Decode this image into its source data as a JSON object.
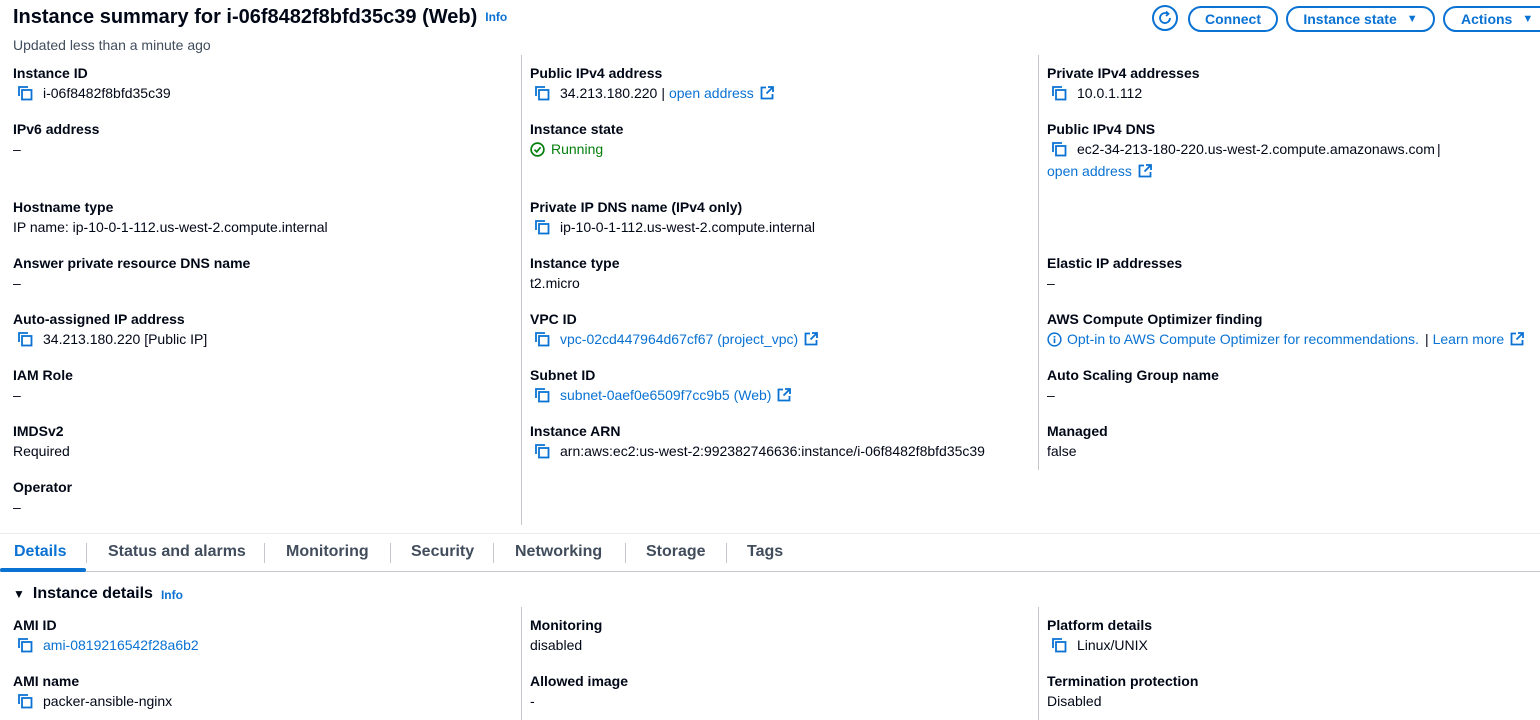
{
  "header": {
    "title": "Instance summary for i-06f8482f8bfd35c39 (Web)",
    "info": "Info",
    "updated": "Updated less than a minute ago",
    "buttons": {
      "connect": "Connect",
      "instance_state": "Instance state",
      "actions": "Actions"
    }
  },
  "summary": {
    "instance_id": {
      "label": "Instance ID",
      "value": "i-06f8482f8bfd35c39"
    },
    "ipv6": {
      "label": "IPv6 address",
      "value": "–"
    },
    "hostname_type": {
      "label": "Hostname type",
      "value": "IP name: ip-10-0-1-112.us-west-2.compute.internal"
    },
    "answer_dns": {
      "label": "Answer private resource DNS name",
      "value": "–"
    },
    "auto_ip": {
      "label": "Auto-assigned IP address",
      "value": "34.213.180.220 [Public IP]"
    },
    "iam_role": {
      "label": "IAM Role",
      "value": "–"
    },
    "imdsv2": {
      "label": "IMDSv2",
      "value": "Required"
    },
    "operator": {
      "label": "Operator",
      "value": "–"
    },
    "public_ipv4": {
      "label": "Public IPv4 address",
      "value": "34.213.180.220",
      "sep": "|",
      "link": "open address"
    },
    "instance_state": {
      "label": "Instance state",
      "value": "Running"
    },
    "private_dns": {
      "label": "Private IP DNS name (IPv4 only)",
      "value": "ip-10-0-1-112.us-west-2.compute.internal"
    },
    "instance_type": {
      "label": "Instance type",
      "value": "t2.micro"
    },
    "vpc_id": {
      "label": "VPC ID",
      "value": "vpc-02cd447964d67cf67 (project_vpc)"
    },
    "subnet_id": {
      "label": "Subnet ID",
      "value": "subnet-0aef0e6509f7cc9b5 (Web)"
    },
    "instance_arn": {
      "label": "Instance ARN",
      "value": "arn:aws:ec2:us-west-2:992382746636:instance/i-06f8482f8bfd35c39"
    },
    "private_ipv4": {
      "label": "Private IPv4 addresses",
      "value": "10.0.1.112"
    },
    "public_dns": {
      "label": "Public IPv4 DNS",
      "value": "ec2-34-213-180-220.us-west-2.compute.amazonaws.com",
      "sep": "|",
      "link": "open address"
    },
    "elastic_ip": {
      "label": "Elastic IP addresses",
      "value": "–"
    },
    "optimizer": {
      "label": "AWS Compute Optimizer finding",
      "value": "Opt-in to AWS Compute Optimizer for recommendations.",
      "sep": "|",
      "link": "Learn more"
    },
    "asg": {
      "label": "Auto Scaling Group name",
      "value": "–"
    },
    "managed": {
      "label": "Managed",
      "value": "false"
    }
  },
  "tabs": [
    {
      "label": "Details"
    },
    {
      "label": "Status and alarms"
    },
    {
      "label": "Monitoring"
    },
    {
      "label": "Security"
    },
    {
      "label": "Networking"
    },
    {
      "label": "Storage"
    },
    {
      "label": "Tags"
    }
  ],
  "details": {
    "title": "Instance details",
    "info": "Info",
    "ami_id": {
      "label": "AMI ID",
      "value": "ami-0819216542f28a6b2"
    },
    "ami_name": {
      "label": "AMI name",
      "value": "packer-ansible-nginx"
    },
    "monitoring": {
      "label": "Monitoring",
      "value": "disabled"
    },
    "allowed_image": {
      "label": "Allowed image",
      "value": "-"
    },
    "platform": {
      "label": "Platform details",
      "value": "Linux/UNIX"
    },
    "termination": {
      "label": "Termination protection",
      "value": "Disabled"
    }
  },
  "colors": {
    "link": "#0972d3",
    "success": "#037f0c",
    "text": "#000716",
    "divider": "#c6c6cd"
  }
}
